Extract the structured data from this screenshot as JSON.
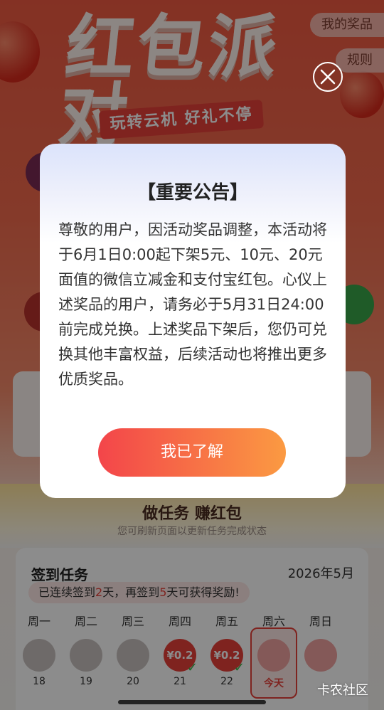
{
  "header": {
    "title": "红包派对",
    "subtitle": "玩转云机 好礼不停",
    "my_prizes_label": "我的奖品",
    "rules_label": "规则"
  },
  "tasks": {
    "title": "做任务 赚红包",
    "note": "您可刷新页面以更新任务完成状态"
  },
  "signin": {
    "title": "签到任务",
    "month": "2026年5月",
    "streak_prefix": "已连续签到",
    "streak_days": "2",
    "streak_middle": "天，再签到",
    "streak_remaining": "5",
    "streak_suffix": "天可获得奖励!",
    "weekdays": [
      "周一",
      "周二",
      "周三",
      "周四",
      "周五",
      "周六",
      "周日"
    ],
    "days": [
      {
        "num": "18",
        "state": "missed",
        "reward": ""
      },
      {
        "num": "19",
        "state": "missed",
        "reward": ""
      },
      {
        "num": "20",
        "state": "missed",
        "reward": ""
      },
      {
        "num": "21",
        "state": "signed",
        "reward": "¥0.2"
      },
      {
        "num": "22",
        "state": "signed",
        "reward": "¥0.2"
      },
      {
        "num": "今天",
        "state": "today",
        "reward": ""
      },
      {
        "num": "",
        "state": "future",
        "reward": ""
      }
    ]
  },
  "watermark": "卡农社区",
  "modal": {
    "title": "【重要公告】",
    "body": "尊敬的用户，因活动奖品调整，本活动将于6月1日0:00起下架5元、10元、20元面值的微信立减金和支付宝红包。心仪上述奖品的用户，请务必于5月31日24:00前完成兑换。上述奖品下架后，您仍可兑换其他丰富权益，后续活动也将推出更多优质奖品。",
    "confirm_label": "我已了解"
  },
  "colors": {
    "accent_red": "#e8413a",
    "button_start": "#f3454a",
    "button_end": "#fb9a42",
    "signed_check": "#3bb54a"
  }
}
